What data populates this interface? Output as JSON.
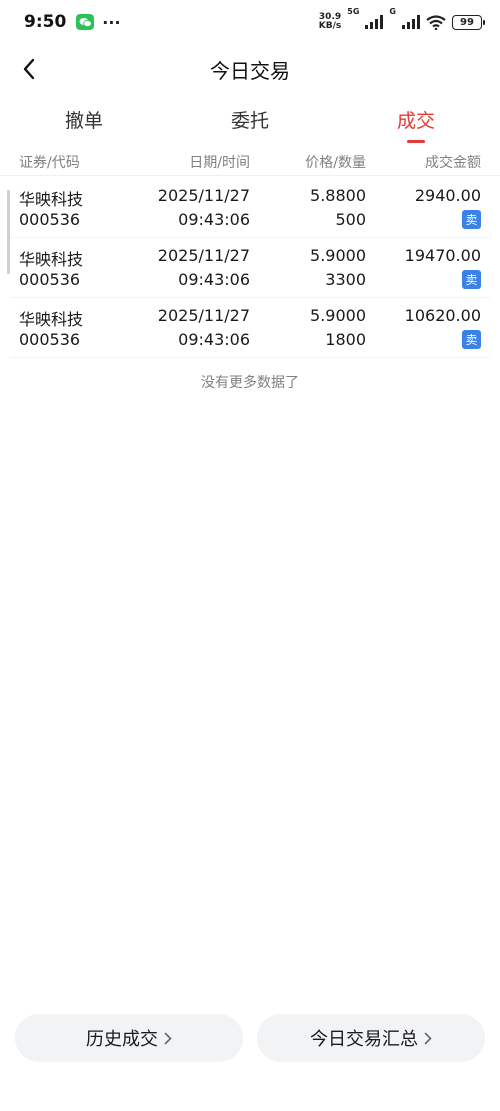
{
  "status_bar": {
    "time": "9:50",
    "dots": "···",
    "net_speed_value": "30.9",
    "net_speed_unit": "KB/s",
    "net_type_1": "5G",
    "net_type_2": "G",
    "battery": "99"
  },
  "header": {
    "title": "今日交易"
  },
  "tabs": [
    {
      "label": "撤单"
    },
    {
      "label": "委托"
    },
    {
      "label": "成交"
    }
  ],
  "columns": {
    "security": "证券/代码",
    "datetime": "日期/时间",
    "price_qty": "价格/数量",
    "amount": "成交金额"
  },
  "rows": [
    {
      "name": "华映科技",
      "code": "000536",
      "date": "2025/11/27",
      "time": "09:43:06",
      "price": "5.8800",
      "qty": "500",
      "amount": "2940.00",
      "side": "卖"
    },
    {
      "name": "华映科技",
      "code": "000536",
      "date": "2025/11/27",
      "time": "09:43:06",
      "price": "5.9000",
      "qty": "3300",
      "amount": "19470.00",
      "side": "卖"
    },
    {
      "name": "华映科技",
      "code": "000536",
      "date": "2025/11/27",
      "time": "09:43:06",
      "price": "5.9000",
      "qty": "1800",
      "amount": "10620.00",
      "side": "卖"
    }
  ],
  "no_more_text": "没有更多数据了",
  "buttons": {
    "history": "历史成交",
    "summary": "今日交易汇总"
  },
  "colors": {
    "accent_red": "#e53935",
    "sell_badge_blue": "#3b82e6",
    "wechat_green": "#2bc25a"
  }
}
